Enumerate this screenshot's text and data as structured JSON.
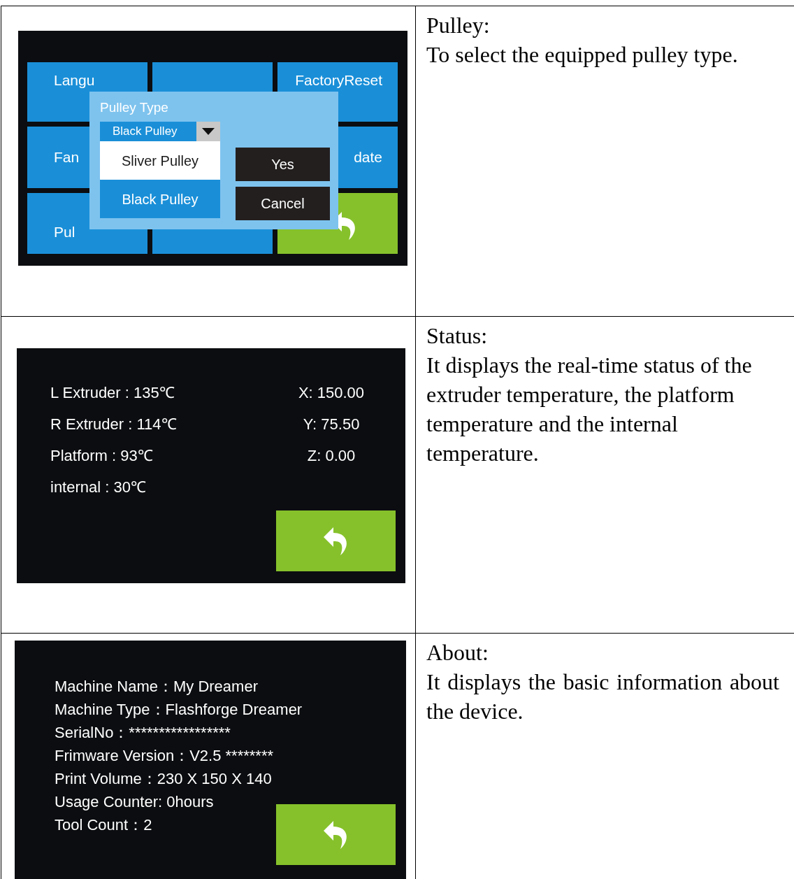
{
  "rows": [
    {
      "screen": {
        "kind": "settings",
        "tiles": [
          {
            "kind": "menu",
            "label": "Langu"
          },
          {
            "kind": "menu"
          },
          {
            "kind": "menu",
            "label": "FactoryReset"
          },
          {
            "kind": "menu",
            "label": "Fan"
          },
          {
            "kind": "menu",
            "label": "date"
          },
          {
            "kind": "menu",
            "label": "Pul"
          },
          {
            "kind": "menu"
          },
          {
            "kind": "back"
          }
        ],
        "dialog": {
          "title": "Pulley Type",
          "dropdown": {
            "value": "Black Pulley",
            "options": [
              {
                "label": "Sliver Pulley",
                "highlighted": true
              },
              {
                "label": "Black Pulley",
                "highlighted": false
              }
            ]
          },
          "buttons": [
            "Yes",
            "Cancel"
          ]
        }
      },
      "description": {
        "heading": "Pulley:",
        "text": "To select the equipped pulley type."
      }
    },
    {
      "screen": {
        "kind": "status",
        "readings": [
          "L Extruder : 135℃",
          "R Extruder : 114℃",
          "Platform : 93℃",
          "internal : 30℃"
        ],
        "coordinates": [
          "X: 150.00",
          "Y: 75.50",
          "Z: 0.00"
        ]
      },
      "description": {
        "heading": "Status:",
        "text": "It displays the real-time status of the extruder temperature, the platform temperature and the internal temperature.",
        "justified": false
      }
    },
    {
      "screen": {
        "kind": "about",
        "lines": [
          "Machine Name：My Dreamer",
          "Machine Type：Flashforge Dreamer",
          "SerialNo：*****************",
          "Frimware Version：V2.5 ********",
          "Print Volume：230 X 150 X 140",
          "Usage Counter: 0hours",
          "Tool Count：2"
        ]
      },
      "description": {
        "heading": "About:",
        "text": "It displays the basic information about the device.",
        "justified": true
      }
    }
  ]
}
